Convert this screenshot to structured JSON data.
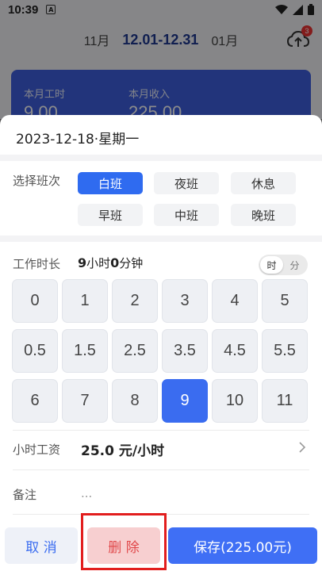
{
  "status_bar": {
    "time": "10:39",
    "notif": "A"
  },
  "header": {
    "prev_month": "11月",
    "current_range": "12.01-12.31",
    "next_month": "01月",
    "upload_badge": "3"
  },
  "summary": {
    "hours_label": "本月工时",
    "hours_value": "9.00",
    "income_label": "本月收入",
    "income_value": "225.00"
  },
  "sheet": {
    "date": "2023-12-18·星期一",
    "shift_label": "选择班次",
    "shifts": [
      "白班",
      "夜班",
      "休息",
      "早班",
      "中班",
      "晚班"
    ],
    "selected_shift": "白班",
    "hours_label": "工作时长",
    "hours_h": "9",
    "hours_h_unit": "小时",
    "hours_m": "0",
    "hours_m_unit": "分钟",
    "unit_hour": "时",
    "unit_minute": "分",
    "keys": [
      "0",
      "1",
      "2",
      "3",
      "4",
      "5",
      "0.5",
      "1.5",
      "2.5",
      "3.5",
      "4.5",
      "5.5",
      "6",
      "7",
      "8",
      "9",
      "10",
      "11"
    ],
    "selected_key": "9",
    "wage_label": "小时工资",
    "wage_value": "25.0 元/小时",
    "note_label": "备注",
    "note_value": "...",
    "cancel_label": "取 消",
    "delete_label": "删 除",
    "save_label": "保存(225.00元)"
  },
  "colors": {
    "accent": "#3f6ff5",
    "delete_bg": "#f7cfd0",
    "highlight": "#e21e1e"
  }
}
